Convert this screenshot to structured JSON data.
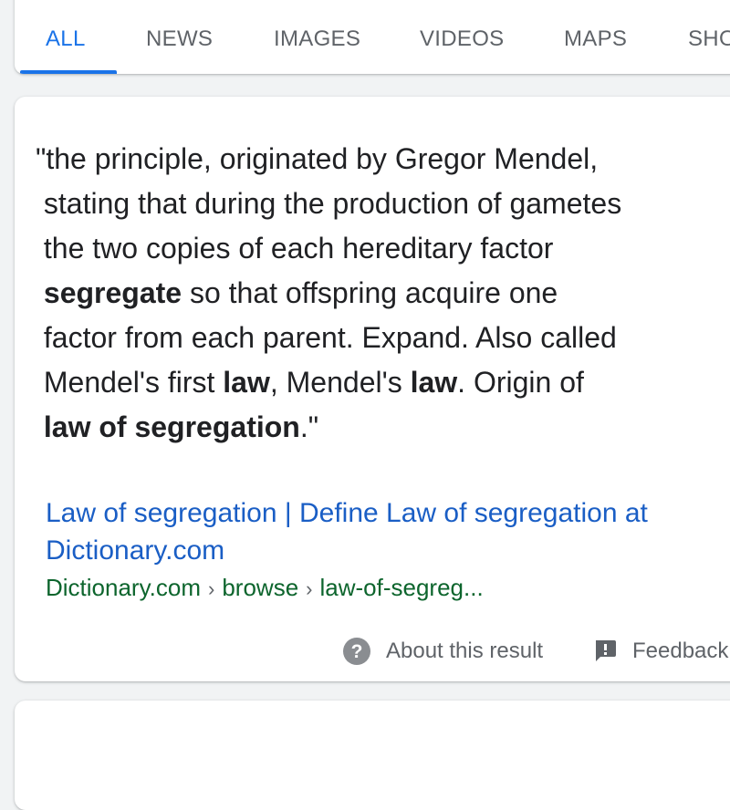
{
  "tabs": {
    "items": [
      {
        "label": "ALL",
        "active": true
      },
      {
        "label": "NEWS",
        "active": false
      },
      {
        "label": "IMAGES",
        "active": false
      },
      {
        "label": "VIDEOS",
        "active": false
      },
      {
        "label": "MAPS",
        "active": false
      },
      {
        "label": "SHO",
        "active": false
      }
    ]
  },
  "result": {
    "snippet": {
      "l1": "\"the principle, originated by Gregor Mendel,",
      "l2": " stating that during the production of gametes",
      "l3": " the two copies of each hereditary factor",
      "l4_bold": " segregate",
      "l4_rest": " so that offspring acquire one",
      "l5": " factor from each parent. Expand. Also called",
      "l6_a": " Mendel's first ",
      "l6_b": "law",
      "l6_c": ", Mendel's ",
      "l6_d": "law",
      "l6_e": ". Origin of",
      "l7_bold": " law of segregation",
      "l7_end": ".\""
    },
    "title": {
      "line1": "Law of segregation | Define Law of segregation at",
      "line2": "Dictionary.com"
    },
    "url": {
      "domain": "Dictionary.com",
      "path1": "browse",
      "path2": "law-of-segreg...",
      "separator": "›"
    },
    "footer": {
      "about_label": "About this result",
      "about_icon": "help-circle-icon",
      "about_icon_glyph": "?",
      "feedback_label": "Feedback",
      "feedback_icon": "feedback-icon"
    }
  },
  "colors": {
    "accent": "#1a73e8",
    "link": "#1a5ec5",
    "url": "#0d652d",
    "text": "#202124",
    "muted": "#5f6368",
    "background": "#f1f3f4"
  }
}
